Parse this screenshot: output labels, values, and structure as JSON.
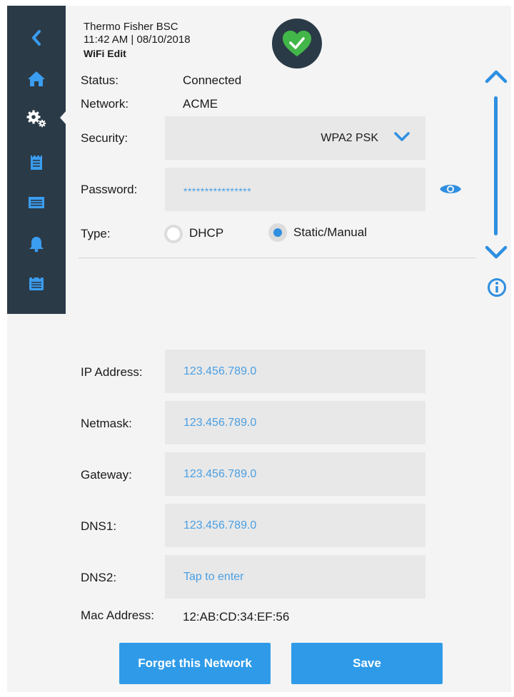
{
  "header": {
    "device_name": "Thermo Fisher BSC",
    "time_date": "11:42 AM | 08/10/2018",
    "page_title": "WiFi Edit",
    "status_icon": "heart-check-icon"
  },
  "sidebar": {
    "items": [
      {
        "name": "back",
        "icon": "chevron-left-icon"
      },
      {
        "name": "home",
        "icon": "home-icon"
      },
      {
        "name": "settings",
        "icon": "gears-icon",
        "active": true
      },
      {
        "name": "log",
        "icon": "notepad-icon"
      },
      {
        "name": "display",
        "icon": "screen-icon"
      },
      {
        "name": "alarms",
        "icon": "bell-icon"
      },
      {
        "name": "calendar",
        "icon": "calendar-icon"
      }
    ]
  },
  "form": {
    "status_label": "Status:",
    "status_value": "Connected",
    "network_label": "Network:",
    "network_value": "ACME",
    "security_label": "Security:",
    "security_value": "WPA2 PSK",
    "password_label": "Password:",
    "password_value": "****************",
    "type_label": "Type:",
    "type_options": [
      "DHCP",
      "Static/Manual"
    ],
    "type_selected": "Static/Manual",
    "ip_label": "IP Address:",
    "ip_value": "123.456.789.0",
    "netmask_label": "Netmask:",
    "netmask_value": "123.456.789.0",
    "gateway_label": "Gateway:",
    "gateway_value": "123.456.789.0",
    "dns1_label": "DNS1:",
    "dns1_value": "123.456.789.0",
    "dns2_label": "DNS2:",
    "dns2_placeholder": "Tap to enter",
    "mac_label": "Mac Address:",
    "mac_value": "12:AB:CD:34:EF:56"
  },
  "actions": {
    "forget_label": "Forget this Network",
    "save_label": "Save"
  },
  "colors": {
    "accent": "#2f9be8",
    "sidebar_bg": "#2b3a47",
    "status_ok": "#43b649"
  }
}
